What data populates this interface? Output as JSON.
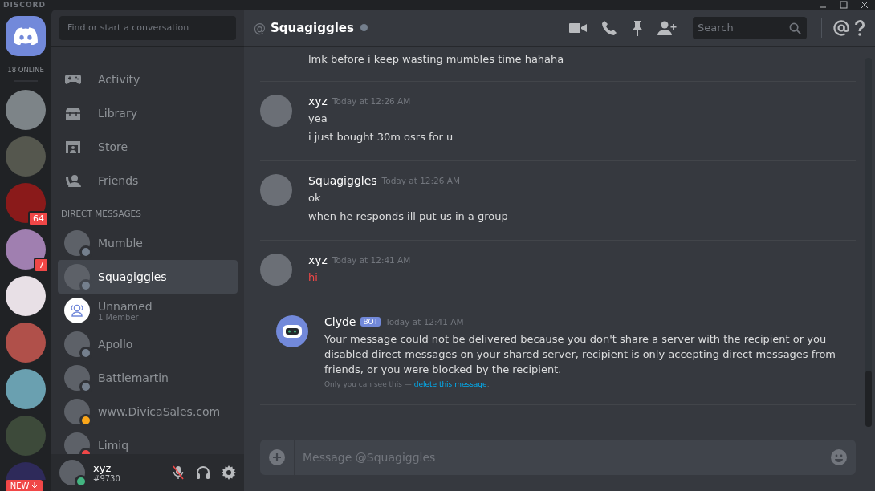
{
  "window": {
    "title": "DISCORD"
  },
  "servers": {
    "online_count": "18 ONLINE",
    "items": [
      {
        "selected": false
      },
      {
        "selected": false
      },
      {
        "selected": false,
        "badge": "64"
      },
      {
        "selected": false,
        "badge": "7"
      },
      {
        "selected": false
      },
      {
        "selected": false
      },
      {
        "selected": false
      },
      {
        "selected": false
      },
      {
        "selected": false
      }
    ],
    "new_pill": "NEW"
  },
  "sidebar": {
    "search": {
      "placeholder": "Find or start a conversation"
    },
    "nav": [
      {
        "kind": "activity",
        "label": "Activity"
      },
      {
        "kind": "library",
        "label": "Library"
      },
      {
        "kind": "store",
        "label": "Store"
      },
      {
        "kind": "friends",
        "label": "Friends"
      }
    ],
    "section_title": "DIRECT MESSAGES",
    "dms": [
      {
        "name": "Mumble",
        "kind": "user",
        "status_dot": {
          "color": "#747f8d"
        },
        "selected": false
      },
      {
        "name": "Squagiggles",
        "kind": "user",
        "status_dot": {
          "color": "#747f8d"
        },
        "selected": true
      },
      {
        "name": "Unnamed",
        "subtitle": "1 Member",
        "kind": "group",
        "selected": false
      },
      {
        "name": "Apollo",
        "kind": "user",
        "status_dot": {
          "color": "#747f8d"
        },
        "selected": false
      },
      {
        "name": "Battlemartin",
        "kind": "user",
        "status_dot": {
          "color": "#747f8d"
        },
        "selected": false
      },
      {
        "name": "www.DivicaSales.com",
        "kind": "user",
        "status_dot": {
          "color": "#faa61a"
        },
        "selected": false
      },
      {
        "name": "Limiq",
        "kind": "user",
        "status_dot": {
          "color": "#f04747"
        },
        "selected": false
      }
    ],
    "user_panel": {
      "name": "xyz",
      "tag": "#9730",
      "status_dot": {
        "color": "#43b581"
      },
      "muted": true
    }
  },
  "chat": {
    "header": {
      "at": "@",
      "name": "Squagiggles",
      "status_dot": {
        "color": "#747f8d"
      },
      "search_placeholder": "Search"
    },
    "messages": [
      {
        "continuation": true,
        "lines": [
          {
            "text": "lmk before i keep wasting mumbles time hahaha",
            "failed": false
          }
        ]
      },
      {
        "author": "xyz",
        "timestamp": "Today at 12:26 AM",
        "lines": [
          {
            "text": "yea",
            "failed": false
          },
          {
            "text": "i just bought 30m osrs for u",
            "failed": false
          }
        ]
      },
      {
        "author": "Squagiggles",
        "timestamp": "Today at 12:26 AM",
        "lines": [
          {
            "text": "ok",
            "failed": false
          },
          {
            "text": "when he responds ill put us in a group",
            "failed": false
          }
        ]
      },
      {
        "author": "xyz",
        "timestamp": "Today at 12:41 AM",
        "lines": [
          {
            "text": "hi",
            "failed": true
          }
        ]
      },
      {
        "author": "Clyde",
        "bot_tag": "BOT",
        "timestamp": "Today at 12:41 AM",
        "lines": [
          {
            "text": "Your message could not be delivered because you don't share a server with the recipient or you disabled direct messages on your shared server, recipient is only accepting direct messages from friends, or you were blocked by the recipient.",
            "failed": false
          }
        ],
        "note": {
          "text": "Only you can see this —",
          "link": "delete this message",
          "suffix": "."
        }
      }
    ],
    "composer": {
      "placeholder": "Message @Squagiggles"
    }
  }
}
